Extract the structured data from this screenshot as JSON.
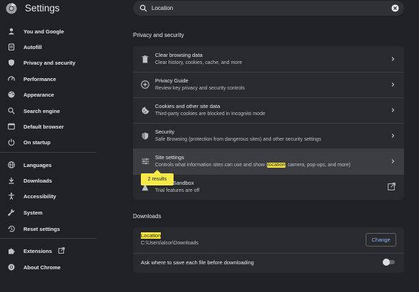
{
  "header": {
    "app_title": "Settings",
    "search_value": "Location",
    "search_icon": "search-icon",
    "clear_icon": "close-icon"
  },
  "sidebar": {
    "items": [
      {
        "label": "You and Google",
        "icon": "person-icon"
      },
      {
        "label": "Autofill",
        "icon": "clipboard-icon"
      },
      {
        "label": "Privacy and security",
        "icon": "shield-icon"
      },
      {
        "label": "Performance",
        "icon": "speedometer-icon"
      },
      {
        "label": "Appearance",
        "icon": "palette-icon"
      },
      {
        "label": "Search engine",
        "icon": "search-icon"
      },
      {
        "label": "Default browser",
        "icon": "browser-icon"
      },
      {
        "label": "On startup",
        "icon": "power-icon"
      },
      {
        "label": "Languages",
        "icon": "globe-icon"
      },
      {
        "label": "Downloads",
        "icon": "download-icon"
      },
      {
        "label": "Accessibility",
        "icon": "accessibility-icon"
      },
      {
        "label": "System",
        "icon": "wrench-icon"
      },
      {
        "label": "Reset settings",
        "icon": "history-icon"
      },
      {
        "label": "Extensions",
        "icon": "puzzle-icon"
      },
      {
        "label": "About Chrome",
        "icon": "chrome-icon"
      }
    ]
  },
  "privacy": {
    "title": "Privacy and security",
    "rows": [
      {
        "title": "Clear browsing data",
        "subtitle": "Clear history, cookies, cache, and more",
        "icon": "trash-icon"
      },
      {
        "title": "Privacy Guide",
        "subtitle": "Review key privacy and security controls",
        "icon": "compass-icon"
      },
      {
        "title": "Cookies and other site data",
        "subtitle": "Third-party cookies are blocked in Incognito mode",
        "icon": "cookie-icon"
      },
      {
        "title": "Security",
        "subtitle": "Safe Browsing (protection from dangerous sites) and other security settings",
        "icon": "shield-icon"
      },
      {
        "title": "Site settings",
        "subtitle_pre": "Controls what information sites can use and show (",
        "subtitle_hl": "location",
        "subtitle_post": ", camera, pop-ups, and more)",
        "icon": "sliders-icon"
      },
      {
        "title_tail": "Sandbox",
        "subtitle": "Trial features are off",
        "icon": "flask-icon"
      }
    ],
    "tooltip": "2 results"
  },
  "downloads": {
    "title": "Downloads",
    "location_label": "Location",
    "location_path": "C:\\Users\\alcor\\Downloads",
    "change_label": "Change",
    "ask_label": "Ask where to save each file before downloading",
    "ask_enabled": false
  },
  "colors": {
    "background": "#202124",
    "card": "#292a2d",
    "highlight": "#ffeb3b",
    "link": "#8ab4f8"
  }
}
